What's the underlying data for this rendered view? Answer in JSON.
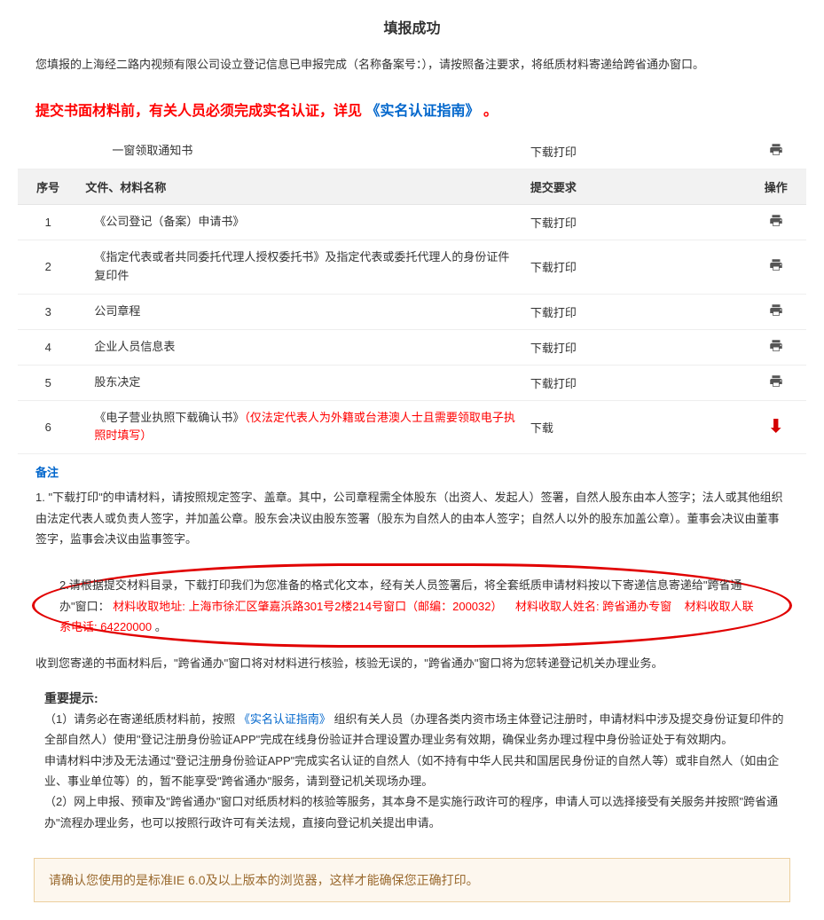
{
  "title": "填报成功",
  "intro": "您填报的上海经二路内视频有限公司设立登记信息已申报完成（名称备案号：），请按照备注要求，将纸质材料寄递给跨省通办窗口。",
  "warning": {
    "part1": "提交书面材料前，有关人员必须完成实名认证，详见",
    "link": "《实名认证指南》",
    "tail": "。"
  },
  "preRow": {
    "name": "一窗领取通知书",
    "req": "下载打印"
  },
  "headers": {
    "num": "序号",
    "name": "文件、材料名称",
    "req": "提交要求",
    "op": "操作"
  },
  "rows": [
    {
      "num": "1",
      "name": "《公司登记（备案）申请书》",
      "req": "下载打印",
      "op": "print"
    },
    {
      "num": "2",
      "name": "《指定代表或者共同委托代理人授权委托书》及指定代表或委托代理人的身份证件复印件",
      "req": "下载打印",
      "op": "print"
    },
    {
      "num": "3",
      "name": "公司章程",
      "req": "下载打印",
      "op": "print"
    },
    {
      "num": "4",
      "name": "企业人员信息表",
      "req": "下载打印",
      "op": "print"
    },
    {
      "num": "5",
      "name": "股东决定",
      "req": "下载打印",
      "op": "print"
    },
    {
      "num": "6",
      "name": "《电子营业执照下载确认书》",
      "note": "（仅法定代表人为外籍或台港澳人士且需要领取电子执照时填写）",
      "req": "下载",
      "op": "arrow"
    }
  ],
  "beizhuTitle": "备注",
  "note1": "1. \"下载打印\"的申请材料，请按照规定签字、盖章。其中，公司章程需全体股东（出资人、发起人）签署，自然人股东由本人签字；法人或其他组织由法定代表人或负责人签字，并加盖公章。股东会决议由股东签署（股东为自然人的由本人签字；自然人以外的股东加盖公章）。董事会决议由董事签字，监事会决议由监事签字。",
  "note2_a": "2.请根据提交材料目录，下载打印我们为您准备的格式化文本，经有关人员签署后，将全套纸质申请材料按以下寄递信息寄递给\"跨省通办\"窗口：",
  "note2_addrLabel": "材料收取地址:",
  "note2_addr": "上海市徐汇区肇嘉浜路301号2楼214号窗口（邮编：200032）",
  "note2_nameLabel": "材料收取人姓名:",
  "note2_name": "跨省通办专窗",
  "note2_telLabel": "材料收取人联系电话:",
  "note2_tel": "64220000",
  "note2_tail": "。",
  "note3": "收到您寄递的书面材料后，\"跨省通办\"窗口将对材料进行核验，核验无误的，\"跨省通办\"窗口将为您转递登记机关办理业务。",
  "importantTitle": "重要提示:",
  "imp1a": "（1）请务必在寄递纸质材料前，按照",
  "imp1link": "《实名认证指南》",
  "imp1b": "组织有关人员（办理各类内资市场主体登记注册时，申请材料中涉及提交身份证复印件的全部自然人）使用\"登记注册身份验证APP\"完成在线身份验证并合理设置办理业务有效期，确保业务办理过程中身份验证处于有效期内。",
  "imp2": "申请材料中涉及无法通过\"登记注册身份验证APP\"完成实名认证的自然人（如不持有中华人民共和国居民身份证的自然人等）或非自然人（如由企业、事业单位等）的，暂不能享受\"跨省通办\"服务，请到登记机关现场办理。",
  "imp3": "（2）网上申报、预审及\"跨省通办\"窗口对纸质材料的核验等服务，其本身不是实施行政许可的程序，申请人可以选择接受有关服务并按照\"跨省通办\"流程办理业务，也可以按照行政许可有关法规，直接向登记机关提出申请。",
  "ieNotice": "请确认您使用的是标准IE 6.0及以上版本的浏览器，这样才能确保您正确打印。"
}
